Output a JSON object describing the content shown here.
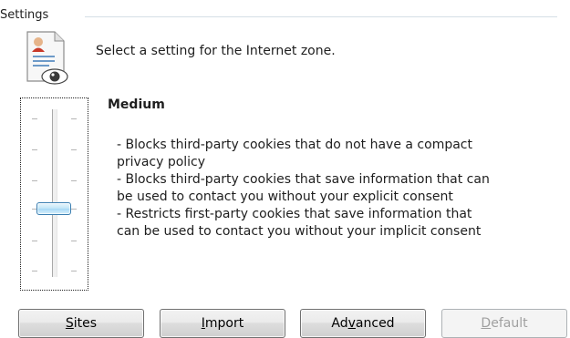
{
  "group": {
    "title": "Settings"
  },
  "zone": {
    "description": "Select a setting for the Internet zone."
  },
  "slider": {
    "level": "Medium",
    "position_index": 2,
    "positions_count": 6
  },
  "level_description": {
    "lines": [
      "- Blocks third-party cookies that do not have a compact",
      "privacy policy",
      "- Blocks third-party cookies that save information that can",
      "be used to contact you without your explicit consent",
      "- Restricts first-party cookies that save information that",
      "can be used to contact you without your implicit consent"
    ]
  },
  "buttons": {
    "sites": {
      "label": "Sites",
      "accel": "S",
      "enabled": true
    },
    "import": {
      "label": "Import",
      "accel": "I",
      "enabled": true
    },
    "advanced": {
      "label": "Advanced",
      "accel": "v",
      "enabled": true
    },
    "default": {
      "label": "Default",
      "accel": "D",
      "enabled": false
    }
  },
  "icons": {
    "zone": "privacy-document-eye-icon"
  }
}
